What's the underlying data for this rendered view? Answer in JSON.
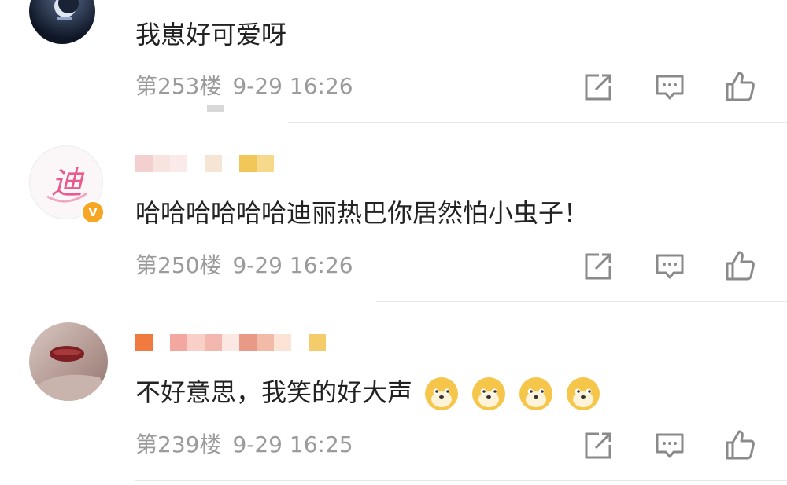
{
  "comments": [
    {
      "text": "我崽好可爱呀",
      "floor": "第253楼",
      "time": "9-29 16:26"
    },
    {
      "text": "哈哈哈哈哈哈迪丽热巴你居然怕小虫子！",
      "floor": "第250楼",
      "time": "9-29 16:26",
      "avatar_text": "迪",
      "badge": "V"
    },
    {
      "text": "不好意思，我笑的好大声",
      "floor": "第239楼",
      "time": "9-29 16:25",
      "emoji": "doge-emoji"
    }
  ],
  "icons": [
    "share-icon",
    "reply-icon",
    "like-icon"
  ],
  "colors": {
    "meta_gray": "#9b9b9b",
    "text": "#222222",
    "badge": "#f5a623",
    "doge": "#f6c64a"
  }
}
